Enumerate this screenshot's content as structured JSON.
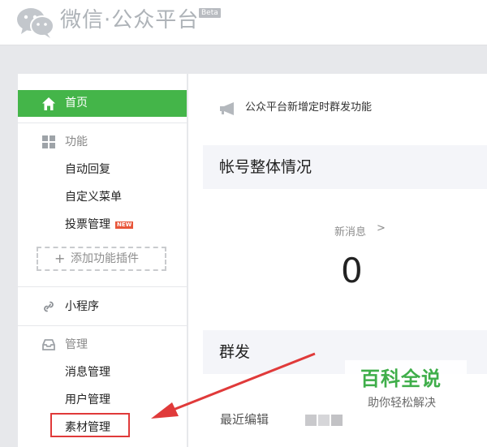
{
  "header": {
    "title": "微信·公众平台",
    "badge": "Beta"
  },
  "sidebar": {
    "home": "首页",
    "functions": {
      "label": "功能",
      "items": [
        "自动回复",
        "自定义菜单",
        "投票管理"
      ],
      "new_badge": "NEW",
      "add_plugin": "添加功能插件"
    },
    "miniprogram": "小程序",
    "manage": {
      "label": "管理",
      "items": [
        "消息管理",
        "用户管理",
        "素材管理"
      ]
    }
  },
  "main": {
    "notice": "公众平台新增定时群发功能",
    "overview_title": "帐号整体情况",
    "new_messages": {
      "label": "新消息",
      "arrow": ">",
      "count": "0"
    },
    "mass_send_title": "群发",
    "recent_edit": "最近编辑"
  },
  "watermark": {
    "main": "百科全说",
    "sub": "助你轻松解决"
  },
  "colors": {
    "accent": "#44b549",
    "highlight": "#e03a3a",
    "watermark": "#3fae4a"
  }
}
